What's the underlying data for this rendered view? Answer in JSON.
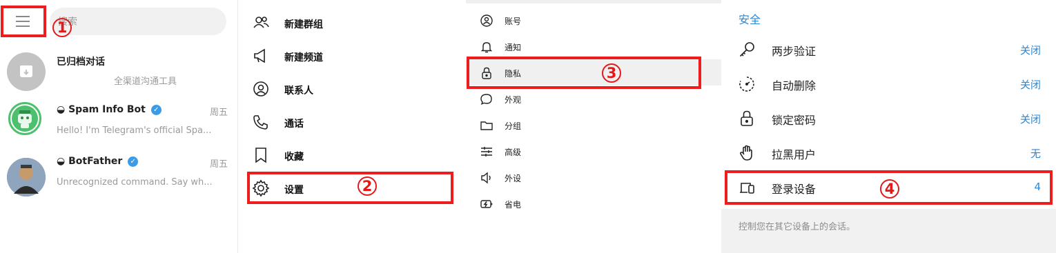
{
  "chat_list": {
    "search_placeholder": "搜索",
    "chats": [
      {
        "title": "已归档对话",
        "preview": "全渠道沟通工具",
        "time": ""
      },
      {
        "title": "Spam Info Bot",
        "preview": "Hello! I'm Telegram's official Spa...",
        "time": "周五"
      },
      {
        "title": "BotFather",
        "preview": "Unrecognized command. Say wh...",
        "time": "周五"
      }
    ]
  },
  "main_menu": {
    "items": [
      {
        "label": "新建群组",
        "icon": "group-icon"
      },
      {
        "label": "新建频道",
        "icon": "megaphone-icon"
      },
      {
        "label": "联系人",
        "icon": "contact-icon"
      },
      {
        "label": "通话",
        "icon": "phone-icon"
      },
      {
        "label": "收藏",
        "icon": "bookmark-icon"
      },
      {
        "label": "设置",
        "icon": "gear-icon"
      }
    ]
  },
  "settings": {
    "items": [
      {
        "label": "账号",
        "icon": "account-icon"
      },
      {
        "label": "通知",
        "icon": "bell-icon"
      },
      {
        "label": "隐私",
        "icon": "lock-icon"
      },
      {
        "label": "外观",
        "icon": "chat-bubble-icon"
      },
      {
        "label": "分组",
        "icon": "folder-icon"
      },
      {
        "label": "高级",
        "icon": "sliders-icon"
      },
      {
        "label": "外设",
        "icon": "speaker-icon"
      },
      {
        "label": "省电",
        "icon": "battery-icon"
      }
    ]
  },
  "security": {
    "heading": "安全",
    "items": [
      {
        "label": "两步验证",
        "value": "关闭",
        "icon": "key-icon"
      },
      {
        "label": "自动删除",
        "value": "关闭",
        "icon": "timer-icon"
      },
      {
        "label": "锁定密码",
        "value": "关闭",
        "icon": "lock-icon"
      },
      {
        "label": "拉黑用户",
        "value": "无",
        "icon": "hand-icon"
      },
      {
        "label": "登录设备",
        "value": "4",
        "icon": "devices-icon"
      }
    ],
    "footer": "控制您在其它设备上的会话。"
  },
  "callouts": [
    "1",
    "2",
    "3",
    "4"
  ],
  "colors": {
    "accent": "#2a87d4",
    "callout_red": "#ee1c1c",
    "verified": "#3a9be8"
  }
}
